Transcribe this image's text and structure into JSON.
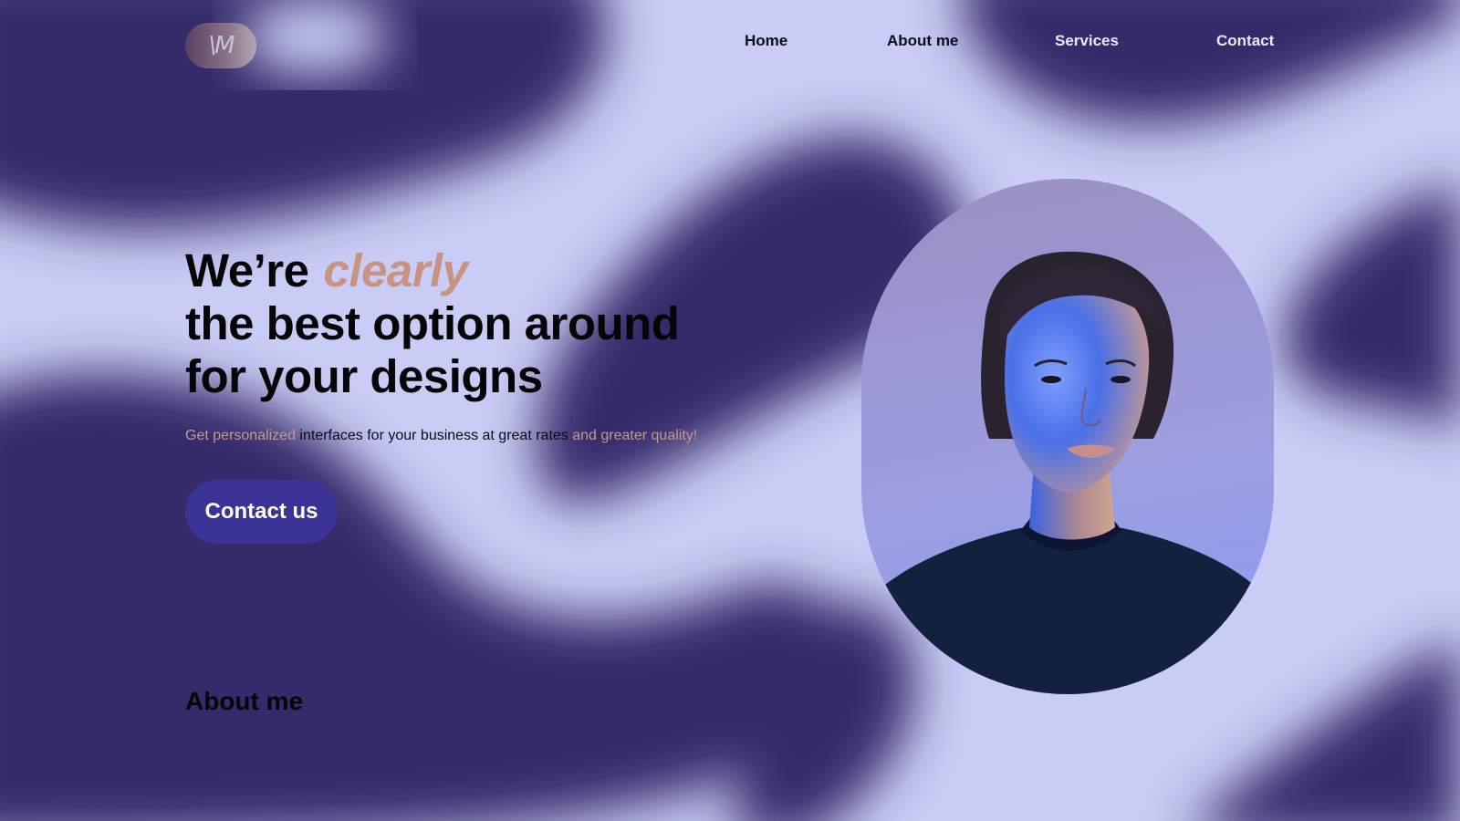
{
  "brand": {
    "logo_text": "\\M"
  },
  "nav": {
    "items": [
      {
        "label": "Home"
      },
      {
        "label": "About me"
      },
      {
        "label": "Services"
      },
      {
        "label": "Contact"
      }
    ]
  },
  "hero": {
    "headline_prefix": "We’re",
    "headline_accent": "clearly",
    "headline_line2": "the best option around",
    "headline_line3": "for your designs",
    "sub_highlight_1": "Get personalized",
    "sub_plain": " interfaces for your business at great rates ",
    "sub_highlight_2": "and greater quality!",
    "cta_label": "Contact us"
  },
  "about": {
    "heading": "About me"
  },
  "colors": {
    "background": "#c9ccf4",
    "blob": "#35296a",
    "accent": "#c79482",
    "cta": "#3b3496"
  },
  "icons": {
    "portrait": "woman-portrait-photo"
  }
}
